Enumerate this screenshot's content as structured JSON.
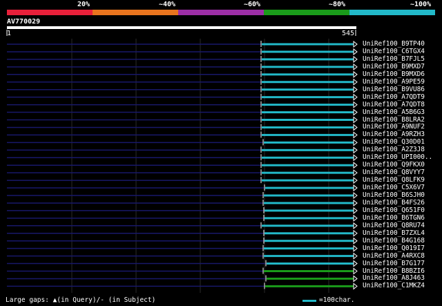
{
  "legend": {
    "labels": [
      "20%",
      "~40%",
      "~60%",
      "~80%",
      "~100%"
    ],
    "colors": [
      "#e8203a",
      "#e8741e",
      "#9c2fa6",
      "#1a9b1a",
      "#22b9c9"
    ]
  },
  "query": {
    "id": "AV770029",
    "start": "1",
    "end": "545"
  },
  "hits": [
    {
      "label": "UniRef100_B9TP40",
      "color": "#22b9c9",
      "start": 378
    },
    {
      "label": "UniRef100_C6TGX4",
      "color": "#22b9c9",
      "start": 378
    },
    {
      "label": "UniRef100_B7FJL5",
      "color": "#22b9c9",
      "start": 378
    },
    {
      "label": "UniRef100_B9MXD7",
      "color": "#22b9c9",
      "start": 378
    },
    {
      "label": "UniRef100_B9MXD6",
      "color": "#22b9c9",
      "start": 378
    },
    {
      "label": "UniRef100_A9PE59",
      "color": "#22b9c9",
      "start": 378
    },
    {
      "label": "UniRef100_B9VU86",
      "color": "#22b9c9",
      "start": 378
    },
    {
      "label": "UniRef100_A7QDT9",
      "color": "#22b9c9",
      "start": 378
    },
    {
      "label": "UniRef100_A7QDT8",
      "color": "#22b9c9",
      "start": 378
    },
    {
      "label": "UniRef100_A5B6G3",
      "color": "#22b9c9",
      "start": 378
    },
    {
      "label": "UniRef100_B8LRA2",
      "color": "#22b9c9",
      "start": 378
    },
    {
      "label": "UniRef100_A9NUF2",
      "color": "#22b9c9",
      "start": 378
    },
    {
      "label": "UniRef100_A9RZH3",
      "color": "#22b9c9",
      "start": 378
    },
    {
      "label": "UniRef100_Q30D01",
      "color": "#22b9c9",
      "start": 381
    },
    {
      "label": "UniRef100_A2Z3J8",
      "color": "#22b9c9",
      "start": 378
    },
    {
      "label": "UniRef100_UPI000..",
      "color": "#22b9c9",
      "start": 378
    },
    {
      "label": "UniRef100_Q9FKX0",
      "color": "#22b9c9",
      "start": 378
    },
    {
      "label": "UniRef100_Q8VYY7",
      "color": "#22b9c9",
      "start": 378
    },
    {
      "label": "UniRef100_Q8LFK9",
      "color": "#22b9c9",
      "start": 378
    },
    {
      "label": "UniRef100_C5X6V7",
      "color": "#22b9c9",
      "start": 383
    },
    {
      "label": "UniRef100_B6SJH0",
      "color": "#22b9c9",
      "start": 381
    },
    {
      "label": "UniRef100_B4FS26",
      "color": "#22b9c9",
      "start": 381
    },
    {
      "label": "UniRef100_Q651F0",
      "color": "#22b9c9",
      "start": 382
    },
    {
      "label": "UniRef100_B6TGN6",
      "color": "#22b9c9",
      "start": 382
    },
    {
      "label": "UniRef100_Q8RU74",
      "color": "#22b9c9",
      "start": 378
    },
    {
      "label": "UniRef100_B7ZXL4",
      "color": "#22b9c9",
      "start": 382
    },
    {
      "label": "UniRef100_B4G168",
      "color": "#22b9c9",
      "start": 382
    },
    {
      "label": "UniRef100_Q019I7",
      "color": "#22b9c9",
      "start": 381
    },
    {
      "label": "UniRef100_A4RXC8",
      "color": "#22b9c9",
      "start": 381
    },
    {
      "label": "UniRef100_B7G177",
      "color": "#22b9c9",
      "start": 385
    },
    {
      "label": "UniRef100_B8BZI6",
      "color": "#1a9b1a",
      "start": 381
    },
    {
      "label": "UniRef100_A8J463",
      "color": "#1a9b1a",
      "start": 385
    },
    {
      "label": "UniRef100_C1MKZ4",
      "color": "#1a9b1a",
      "start": 383
    }
  ],
  "footer": {
    "gaps_text": "Large gaps: ▲(in Query)/- (in Subject)",
    "scale_text": "=100char."
  }
}
